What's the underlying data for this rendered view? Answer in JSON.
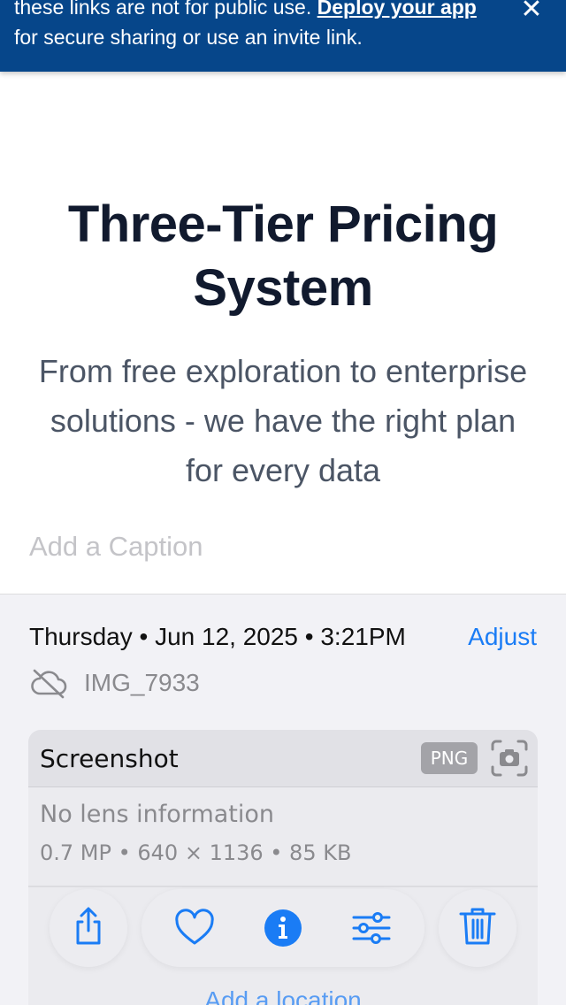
{
  "banner": {
    "text_prefix": "these links are not for public use. ",
    "link_text": "Deploy your app",
    "text_suffix": " for secure sharing or use an invite link.",
    "close_glyph": "✕"
  },
  "hero": {
    "title": "Three-Tier Pricing System",
    "subtitle": "From free exploration to enterprise solutions - we have the right plan for every data"
  },
  "caption": {
    "placeholder": "Add a Caption"
  },
  "info": {
    "date_text": "Thursday • Jun 12, 2025 • 3:21PM",
    "adjust_label": "Adjust",
    "file_name": "IMG_7933",
    "cloud_icon": "cloud-slash-icon"
  },
  "card": {
    "title": "Screenshot",
    "format_badge": "PNG",
    "lens_icon": "camera-viewfinder-icon",
    "lens_text": "No lens information",
    "specs_text": "0.7 MP • 640 × 1136 • 85 KB"
  },
  "location": {
    "label": "Add a location"
  },
  "toolbar": {
    "icons": [
      "share-icon",
      "heart-icon",
      "info-icon",
      "adjust-icon",
      "trash-icon"
    ],
    "accent_color": "#1a7cf5"
  },
  "colors": {
    "banner_bg": "#06468a",
    "accent": "#1a7cf5",
    "title_text": "#111a2e",
    "subtitle_text": "#4b5565"
  }
}
